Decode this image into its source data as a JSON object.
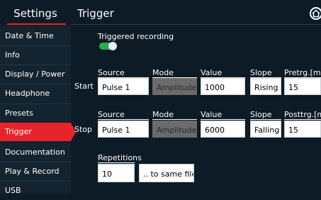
{
  "sidebar": {
    "title": "Settings",
    "items": [
      {
        "label": "Date & Time"
      },
      {
        "label": "Info"
      },
      {
        "label": "Display / Power"
      },
      {
        "label": "Headphone"
      },
      {
        "label": "Presets"
      },
      {
        "label": "Trigger"
      },
      {
        "label": "Documentation"
      },
      {
        "label": "Play & Record"
      },
      {
        "label": "USB"
      }
    ],
    "active_index": 5
  },
  "header": {
    "title": "Trigger",
    "icon": "home-icon"
  },
  "triggered_recording": {
    "label": "Triggered recording",
    "enabled": true
  },
  "start": {
    "row_label": "Start",
    "headers": {
      "source": "Source",
      "mode": "Mode",
      "value": "Value",
      "slope": "Slope",
      "time": "Pretrg.[ms]"
    },
    "source": "Pulse 1",
    "mode": "Amplitude",
    "value": "1000",
    "slope": "Rising",
    "time": "15"
  },
  "stop": {
    "row_label": "Stop",
    "headers": {
      "source": "Source",
      "mode": "Mode",
      "value": "Value",
      "slope": "Slope",
      "time": "Posttrg.[ms]"
    },
    "source": "Pulse 1",
    "mode": "Amplitude",
    "value": "6000",
    "slope": "Falling",
    "time": "15"
  },
  "repetitions": {
    "label": "Repetitions",
    "value": "10",
    "target": ".. to same file"
  },
  "colors": {
    "accent": "#e8232b",
    "background": "#0d1b26",
    "sidebar": "#13232f",
    "toggle_on": "#2fa84f",
    "disabled_field": "#6b6b6b"
  }
}
